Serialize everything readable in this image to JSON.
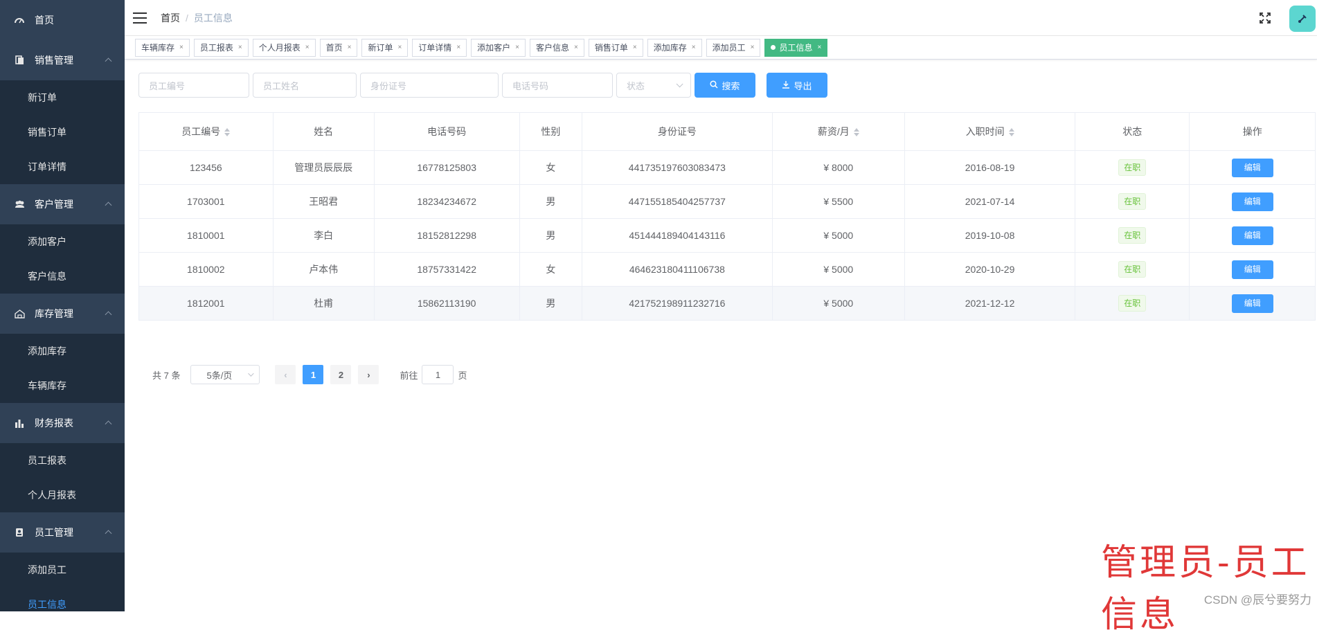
{
  "sidebar": {
    "home": "首页",
    "groups": [
      {
        "title": "销售管理",
        "icon": "document-icon",
        "items": [
          "新订单",
          "销售订单",
          "订单详情"
        ]
      },
      {
        "title": "客户管理",
        "icon": "users-icon",
        "items": [
          "添加客户",
          "客户信息"
        ]
      },
      {
        "title": "库存管理",
        "icon": "warehouse-icon",
        "items": [
          "添加库存",
          "车辆库存"
        ]
      },
      {
        "title": "财务报表",
        "icon": "bar-chart-icon",
        "items": [
          "员工报表",
          "个人月报表"
        ]
      },
      {
        "title": "员工管理",
        "icon": "badge-icon",
        "items": [
          "添加员工",
          "员工信息"
        ]
      }
    ],
    "active_item": "员工信息"
  },
  "breadcrumb": {
    "home": "首页",
    "sep": "/",
    "current": "员工信息"
  },
  "tags": [
    "车辆库存",
    "员工报表",
    "个人月报表",
    "首页",
    "新订单",
    "订单详情",
    "添加客户",
    "客户信息",
    "销售订单",
    "添加库存",
    "添加员工",
    "员工信息"
  ],
  "tag_close": "×",
  "filters": {
    "emp_id": "员工编号",
    "emp_name": "员工姓名",
    "id_card": "身份证号",
    "phone": "电话号码",
    "status": "状态",
    "search": "搜索",
    "export": "导出"
  },
  "table": {
    "headers": [
      "员工编号",
      "姓名",
      "电话号码",
      "性别",
      "身份证号",
      "薪资/月",
      "入职时间",
      "状态",
      "操作"
    ],
    "rows": [
      [
        "123456",
        "管理员辰辰辰",
        "16778125803",
        "女",
        "441735197603083473",
        "¥ 8000",
        "2016-08-19",
        "在职",
        "编辑"
      ],
      [
        "1703001",
        "王昭君",
        "18234234672",
        "男",
        "447155185404257737",
        "¥ 5500",
        "2021-07-14",
        "在职",
        "编辑"
      ],
      [
        "1810001",
        "李白",
        "18152812298",
        "男",
        "451444189404143116",
        "¥ 5000",
        "2019-10-08",
        "在职",
        "编辑"
      ],
      [
        "1810002",
        "卢本伟",
        "18757331422",
        "女",
        "464623180411106738",
        "¥ 5000",
        "2020-10-29",
        "在职",
        "编辑"
      ],
      [
        "1812001",
        "杜甫",
        "15862113190",
        "男",
        "421752198911232716",
        "¥ 5000",
        "2021-12-12",
        "在职",
        "编辑"
      ]
    ]
  },
  "pagination": {
    "total": "共 7 条",
    "page_size": "5条/页",
    "pages": [
      "1",
      "2"
    ],
    "current": "1",
    "goto_prefix": "前往",
    "goto_value": "1",
    "goto_suffix": "页",
    "prev": "‹",
    "next": "›"
  },
  "caption": "管理员-员工信息",
  "watermark": "CSDN @辰兮要努力",
  "colors": {
    "primary": "#409eff",
    "sidebar": "#304156",
    "tag_active": "#42b983",
    "success": "#67c23a",
    "caption": "#e03838"
  }
}
